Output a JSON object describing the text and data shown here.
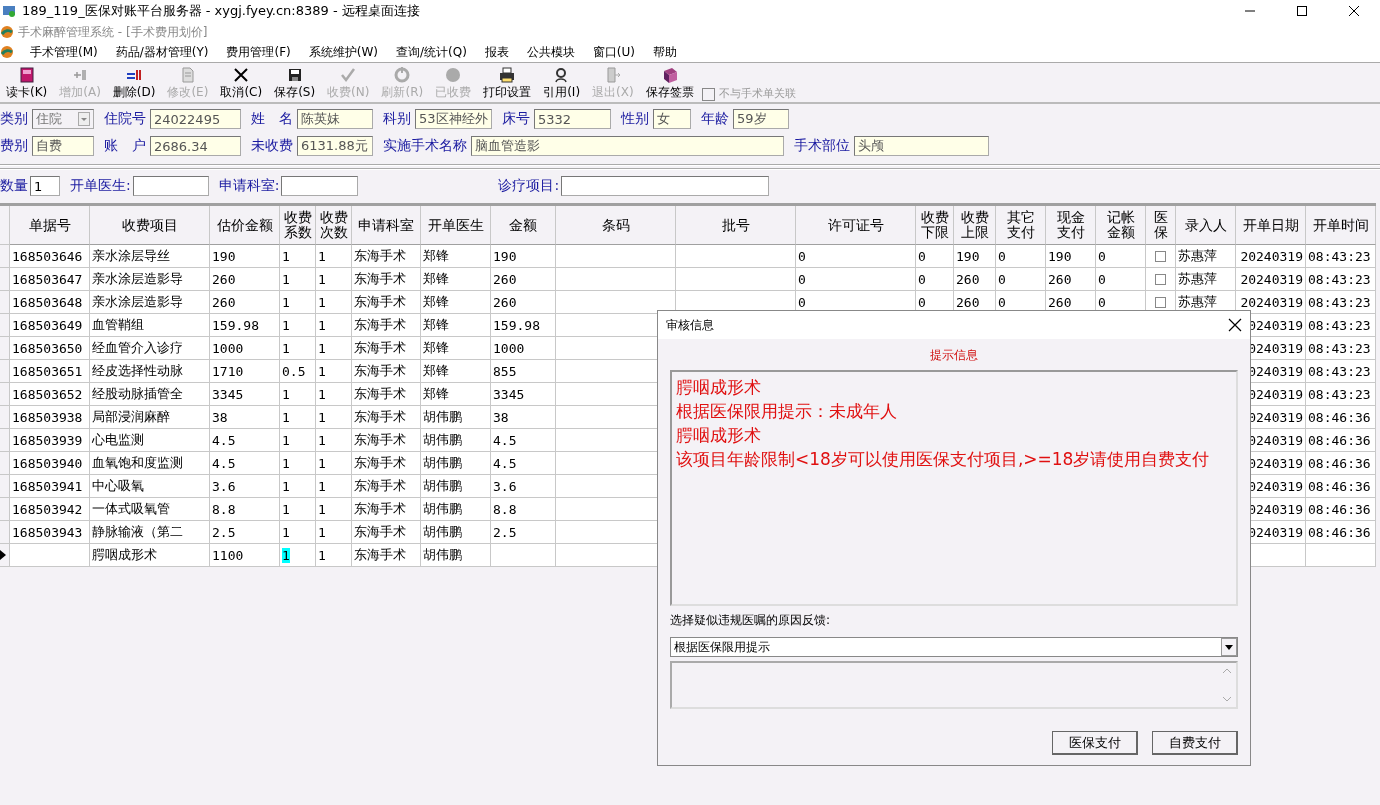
{
  "window": {
    "title": "189_119_医保对账平台服务器 - xygj.fyey.cn:8389 - 远程桌面连接"
  },
  "app_title": "手术麻醉管理系统 - [手术费用划价]",
  "menu": [
    "手术管理(M)",
    "药品/器材管理(Y)",
    "费用管理(F)",
    "系统维护(W)",
    "查询/统计(Q)",
    "报表",
    "公共模块",
    "窗口(U)",
    "帮助"
  ],
  "toolbar": [
    {
      "label": "读卡(K)",
      "disabled": false
    },
    {
      "label": "增加(A)",
      "disabled": true
    },
    {
      "label": "删除(D)",
      "disabled": false
    },
    {
      "label": "修改(E)",
      "disabled": true
    },
    {
      "label": "取消(C)",
      "disabled": false
    },
    {
      "label": "保存(S)",
      "disabled": false
    },
    {
      "label": "收费(N)",
      "disabled": true
    },
    {
      "label": "刷新(R)",
      "disabled": true
    },
    {
      "label": "已收费",
      "disabled": true
    },
    {
      "label": "打印设置",
      "disabled": false
    },
    {
      "label": "引用(I)",
      "disabled": false
    },
    {
      "label": "退出(X)",
      "disabled": true
    },
    {
      "label": "保存签票",
      "disabled": false
    }
  ],
  "unlink_checkbox": {
    "label": "不与手术单关联",
    "checked": false,
    "disabled": true
  },
  "patient_form": [
    [
      {
        "label": "类别",
        "value": "住院",
        "kind": "combo"
      },
      {
        "label": "住院号",
        "value": "24022495",
        "kind": "text"
      },
      {
        "label": "姓　名",
        "value": "陈英妹",
        "kind": "text"
      },
      {
        "label": "科别",
        "value": "53区神经外",
        "kind": "text"
      },
      {
        "label": "床号",
        "value": "5332",
        "kind": "text"
      },
      {
        "label": "性别",
        "value": "女",
        "kind": "text"
      },
      {
        "label": "年龄",
        "value": "59岁",
        "kind": "text"
      }
    ],
    [
      {
        "label": "费别",
        "value": "自费",
        "kind": "text"
      },
      {
        "label": "账　户",
        "value": "2686.34",
        "kind": "text"
      },
      {
        "label": "未收费",
        "value": "6131.88元",
        "kind": "text"
      },
      {
        "label": "实施手术名称",
        "value": "脑血管造影",
        "kind": "text"
      },
      {
        "label": "手术部位",
        "value": "头颅",
        "kind": "text"
      }
    ]
  ],
  "filters": [
    {
      "label": "数量",
      "value": "1"
    },
    {
      "label": "开单医生:"
    },
    {
      "label": "申请科室:"
    },
    {
      "label": "诊疗项目:"
    }
  ],
  "table": {
    "columns": [
      "单据号",
      "收费项目",
      "估价金额",
      "收费系数",
      "收费次数",
      "申请科室",
      "开单医生",
      "金额",
      "条码",
      "批号",
      "许可证号",
      "收费下限",
      "收费上限",
      "其它支付",
      "现金支付",
      "记帐金额",
      "医保",
      "录入人",
      "开单日期",
      "开单时间"
    ],
    "rows": [
      {
        "selected": false,
        "id": "168503646",
        "item": "亲水涂层导丝",
        "est": "190",
        "coef": "1",
        "times": "1",
        "dept": "东海手术",
        "doctor": "郑锋",
        "amount": "190",
        "license": "0",
        "lower": "0",
        "upper": "190",
        "other": "0",
        "cash": "190",
        "account": "0",
        "insured": false,
        "entered_by": "苏惠萍",
        "date": "20240319",
        "time": "08:43:23"
      },
      {
        "selected": false,
        "id": "168503647",
        "item": "亲水涂层造影导",
        "est": "260",
        "coef": "1",
        "times": "1",
        "dept": "东海手术",
        "doctor": "郑锋",
        "amount": "260",
        "license": "0",
        "lower": "0",
        "upper": "260",
        "other": "0",
        "cash": "260",
        "account": "0",
        "insured": false,
        "entered_by": "苏惠萍",
        "date": "20240319",
        "time": "08:43:23"
      },
      {
        "selected": false,
        "id": "168503648",
        "item": "亲水涂层造影导",
        "est": "260",
        "coef": "1",
        "times": "1",
        "dept": "东海手术",
        "doctor": "郑锋",
        "amount": "260",
        "license": "0",
        "lower": "0",
        "upper": "260",
        "other": "0",
        "cash": "260",
        "account": "0",
        "insured": false,
        "entered_by": "苏惠萍",
        "date": "20240319",
        "time": "08:43:23"
      },
      {
        "selected": false,
        "id": "168503649",
        "item": "血管鞘组",
        "est": "159.98",
        "coef": "1",
        "times": "1",
        "dept": "东海手术",
        "doctor": "郑锋",
        "amount": "159.98",
        "date": "0240319",
        "time": "08:43:23"
      },
      {
        "selected": false,
        "id": "168503650",
        "item": "经血管介入诊疗",
        "est": "1000",
        "coef": "1",
        "times": "1",
        "dept": "东海手术",
        "doctor": "郑锋",
        "amount": "1000",
        "date": "0240319",
        "time": "08:43:23"
      },
      {
        "selected": false,
        "id": "168503651",
        "item": "经皮选择性动脉",
        "est": "1710",
        "coef": "0.5",
        "times": "1",
        "dept": "东海手术",
        "doctor": "郑锋",
        "amount": "855",
        "date": "0240319",
        "time": "08:43:23"
      },
      {
        "selected": false,
        "id": "168503652",
        "item": "经股动脉插管全",
        "est": "3345",
        "coef": "1",
        "times": "1",
        "dept": "东海手术",
        "doctor": "郑锋",
        "amount": "3345",
        "date": "0240319",
        "time": "08:43:23"
      },
      {
        "selected": false,
        "id": "168503938",
        "item": "局部浸润麻醉",
        "est": "38",
        "coef": "1",
        "times": "1",
        "dept": "东海手术",
        "doctor": "胡伟鹏",
        "amount": "38",
        "date": "0240319",
        "time": "08:46:36"
      },
      {
        "selected": false,
        "id": "168503939",
        "item": "心电监测",
        "est": "4.5",
        "coef": "1",
        "times": "1",
        "dept": "东海手术",
        "doctor": "胡伟鹏",
        "amount": "4.5",
        "date": "0240319",
        "time": "08:46:36"
      },
      {
        "selected": false,
        "id": "168503940",
        "item": "血氧饱和度监测",
        "est": "4.5",
        "coef": "1",
        "times": "1",
        "dept": "东海手术",
        "doctor": "胡伟鹏",
        "amount": "4.5",
        "date": "0240319",
        "time": "08:46:36"
      },
      {
        "selected": false,
        "id": "168503941",
        "item": "中心吸氧",
        "est": "3.6",
        "coef": "1",
        "times": "1",
        "dept": "东海手术",
        "doctor": "胡伟鹏",
        "amount": "3.6",
        "date": "0240319",
        "time": "08:46:36"
      },
      {
        "selected": false,
        "id": "168503942",
        "item": "一体式吸氧管",
        "est": "8.8",
        "coef": "1",
        "times": "1",
        "dept": "东海手术",
        "doctor": "胡伟鹏",
        "amount": "8.8",
        "date": "0240319",
        "time": "08:46:36"
      },
      {
        "selected": false,
        "id": "168503943",
        "item": "静脉输液（第二",
        "est": "2.5",
        "coef": "1",
        "times": "1",
        "dept": "东海手术",
        "doctor": "胡伟鹏",
        "amount": "2.5",
        "date": "0240319",
        "time": "08:46:36"
      },
      {
        "selected": true,
        "item": "腭咽成形术",
        "est": "1100",
        "coef": "1",
        "times": "1",
        "dept": "东海手术",
        "doctor": "胡伟鹏"
      }
    ]
  },
  "dialog": {
    "title": "审核信息",
    "heading": "提示信息",
    "messages": [
      "腭咽成形术",
      "根据医保限用提示：未成年人",
      "腭咽成形术",
      "该项目年龄限制<18岁可以使用医保支付项目,>=18岁请使用自费支付"
    ],
    "reason_label": "选择疑似违规医嘱的原因反馈:",
    "reason": "根据医保限用提示",
    "buttons": [
      "医保支付",
      "自费支付"
    ]
  }
}
